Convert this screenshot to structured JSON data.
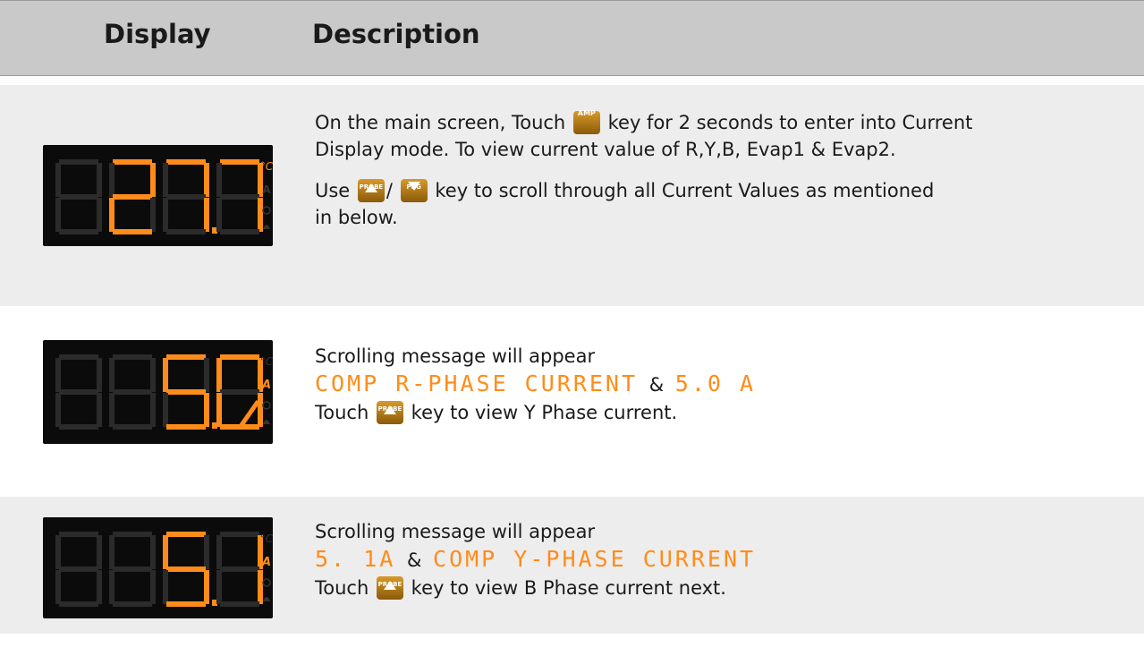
{
  "header": {
    "display_label": "Display",
    "description_label": "Description"
  },
  "keys": {
    "amp": "AMP",
    "probe": "PROBE",
    "prg": "PRG"
  },
  "rows": [
    {
      "display": {
        "digits": "27.7",
        "unit": "°C"
      },
      "line1_pre": "On the main screen, Touch",
      "line1_post": "key for 2 seconds to enter into Current",
      "line2": "Display mode. To view current value of R,Y,B, Evap1 & Evap2.",
      "line3_pre": "Use",
      "line3_sep": "/",
      "line3_post": "key to scroll through all Current Values as mentioned",
      "line4": "in below."
    },
    {
      "display": {
        "digits": "5.0",
        "unit": "A"
      },
      "scroll_label": "Scrolling message will appear",
      "seg_a": "COMP R-PHASE CURRENT",
      "amp": "&",
      "seg_b": "5.0 A",
      "touch_pre": "Touch",
      "touch_post": "key to view Y Phase current."
    },
    {
      "display": {
        "digits": "5.1",
        "unit": "A"
      },
      "scroll_label": "Scrolling message will appear",
      "seg_a": "5. 1A",
      "amp": "&",
      "seg_b": "COMP Y-PHASE CURRENT",
      "touch_pre": "Touch",
      "touch_post": "key to view B Phase current next."
    }
  ],
  "colors": {
    "segment_on": "#ff8c1a",
    "header_bg": "#c9c9c9",
    "row_shade": "#ededed"
  }
}
